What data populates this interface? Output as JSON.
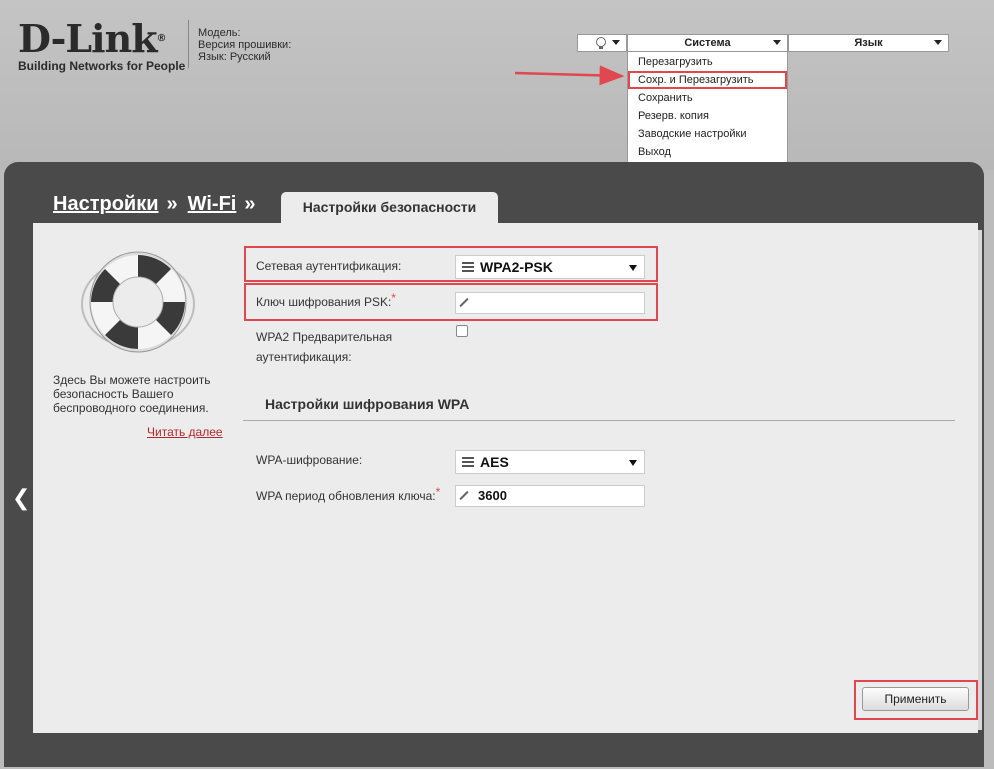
{
  "header": {
    "logo_text": "D-Link",
    "logo_reg": "®",
    "logo_tagline": "Building Networks for People",
    "device": {
      "model_label": "Модель:",
      "firmware_label": "Версия прошивки:",
      "language_label": "Язык: Русский"
    },
    "system_menu_label": "Система",
    "language_menu_label": "Язык",
    "system_menu_items": [
      "Перезагрузить",
      "Сохр. и Перезагрузить",
      "Сохранить",
      "Резерв. копия",
      "Заводские настройки",
      "Выход"
    ]
  },
  "breadcrumb": {
    "item1": "Настройки",
    "sep1": "»",
    "item2": "Wi-Fi",
    "sep2": "»",
    "current_tab": "Настройки безопасности"
  },
  "sidebar": {
    "help_text": "Здесь Вы можете настроить безопасность Вашего беспроводного соединения.",
    "more_link": "Читать далее"
  },
  "form": {
    "auth_label": "Сетевая аутентификация:",
    "auth_value": "WPA2-PSK",
    "psk_label": "Ключ шифрования PSK:",
    "psk_value": "",
    "preauth_label_line1": "WPA2 Предварительная",
    "preauth_label_line2": "аутентификация:",
    "preauth_checked": false,
    "required_mark": "*",
    "wpa_section_title": "Настройки шифрования WPA",
    "wpa_cipher_label": "WPA-шифрование:",
    "wpa_cipher_value": "AES",
    "rekey_label": "WPA период обновления ключа:",
    "rekey_value": "3600"
  },
  "actions": {
    "apply_label": "Применить"
  },
  "colors": {
    "highlight": "#e0474e",
    "panel_dark": "#4a4a4a",
    "content_bg": "#ececec"
  }
}
